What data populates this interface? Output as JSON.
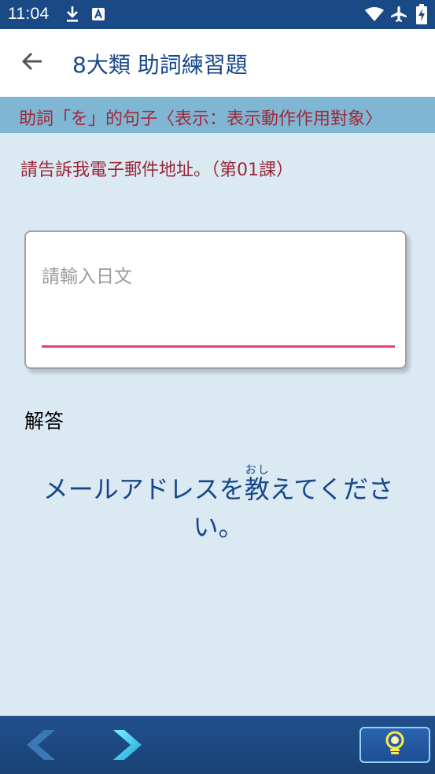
{
  "status_bar": {
    "time": "11:04",
    "icons": [
      "download-icon",
      "text-icon",
      "wifi-icon",
      "airplane-mode-icon",
      "battery-charging-icon"
    ]
  },
  "app_bar": {
    "back_icon": "arrow-left-icon",
    "title": "8大類 助詞練習題"
  },
  "category": {
    "label": "助詞「を」的句子〈表示：表示動作作用對象〉"
  },
  "question": {
    "prompt": "請告訴我電子郵件地址。（第01課）"
  },
  "input": {
    "placeholder": "請輸入日文",
    "value": ""
  },
  "answer": {
    "label": "解答",
    "before": "メールアドレスを",
    "kanji": "教",
    "furigana": "おし",
    "after": "えてください。"
  },
  "bottom_nav": {
    "prev_icon": "chevron-left-icon",
    "next_icon": "chevron-right-icon",
    "hint_icon": "lightbulb-icon"
  },
  "colors": {
    "primary": "#17478c",
    "accent": "#e63d7b",
    "question": "#9b2737",
    "category_bg": "#7fb6d3",
    "page_bg": "#dbe9f3"
  }
}
